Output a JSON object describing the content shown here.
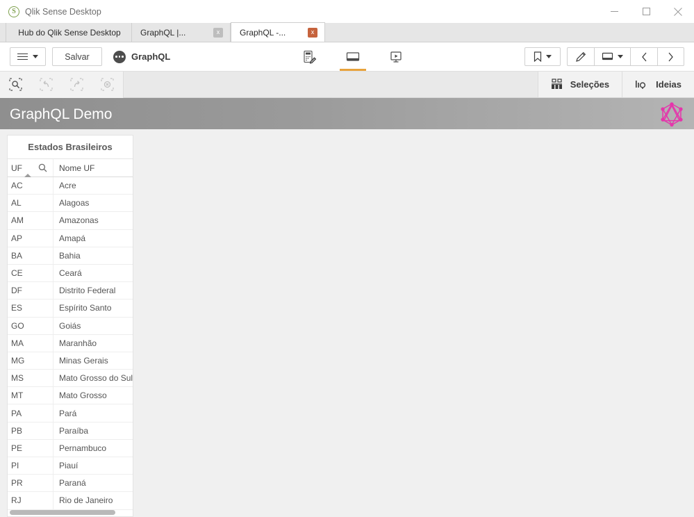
{
  "window": {
    "app_icon": "qlik-sense-icon",
    "title": "Qlik Sense Desktop",
    "minimize_label": "Minimizar",
    "maximize_label": "Maximizar",
    "close_label": "Fechar"
  },
  "tabs": [
    {
      "label": "Hub do Qlik Sense Desktop",
      "active": false,
      "closable": false
    },
    {
      "label": "GraphQL |...",
      "active": false,
      "closable": true,
      "close_label": "x"
    },
    {
      "label": "GraphQL -...",
      "active": true,
      "closable": true,
      "close_label": "x"
    }
  ],
  "toolbar": {
    "menu_label": "",
    "save_label": "Salvar",
    "app_name": "GraphQL",
    "center_icons": [
      {
        "name": "data-load-editor-icon",
        "active": false
      },
      {
        "name": "sheet-icon",
        "active": true
      },
      {
        "name": "storytelling-icon",
        "active": false
      }
    ],
    "bookmark_label": "",
    "edit_label": "",
    "sheet_menu_label": "",
    "prev_label": "‹",
    "next_label": "›"
  },
  "selections_bar": {
    "tools": [
      {
        "name": "selection-search-icon",
        "disabled": false
      },
      {
        "name": "step-back-icon",
        "disabled": true
      },
      {
        "name": "step-forward-icon",
        "disabled": true
      },
      {
        "name": "clear-selections-icon",
        "disabled": true
      }
    ],
    "selections_label": "Seleções",
    "insights_label": "Ideias"
  },
  "sheet": {
    "title": "GraphQL Demo",
    "logo": "graphql-logo",
    "logo_color": "#e535ab"
  },
  "table": {
    "title": "Estados Brasileiros",
    "columns": [
      "UF",
      "Nome UF"
    ],
    "sort_column": "UF",
    "sort_direction": "ascending",
    "search_icon": "search-icon",
    "rows": [
      {
        "uf": "AC",
        "nome": "Acre"
      },
      {
        "uf": "AL",
        "nome": "Alagoas"
      },
      {
        "uf": "AM",
        "nome": "Amazonas"
      },
      {
        "uf": "AP",
        "nome": "Amapá"
      },
      {
        "uf": "BA",
        "nome": "Bahia"
      },
      {
        "uf": "CE",
        "nome": "Ceará"
      },
      {
        "uf": "DF",
        "nome": "Distrito Federal"
      },
      {
        "uf": "ES",
        "nome": "Espírito Santo"
      },
      {
        "uf": "GO",
        "nome": "Goiás"
      },
      {
        "uf": "MA",
        "nome": "Maranhão"
      },
      {
        "uf": "MG",
        "nome": "Minas Gerais"
      },
      {
        "uf": "MS",
        "nome": "Mato Grosso do Sul"
      },
      {
        "uf": "MT",
        "nome": "Mato Grosso"
      },
      {
        "uf": "PA",
        "nome": "Pará"
      },
      {
        "uf": "PB",
        "nome": "Paraíba"
      },
      {
        "uf": "PE",
        "nome": "Pernambuco"
      },
      {
        "uf": "PI",
        "nome": "Piauí"
      },
      {
        "uf": "PR",
        "nome": "Paraná"
      },
      {
        "uf": "RJ",
        "nome": "Rio de Janeiro"
      }
    ]
  },
  "colors": {
    "accent_orange": "#e8a33d",
    "tab_close_active": "#c6633d",
    "canvas_bg": "#f0f0f0",
    "header_gradient_start": "#8f8f8f",
    "header_gradient_end": "#b4b4b4"
  }
}
